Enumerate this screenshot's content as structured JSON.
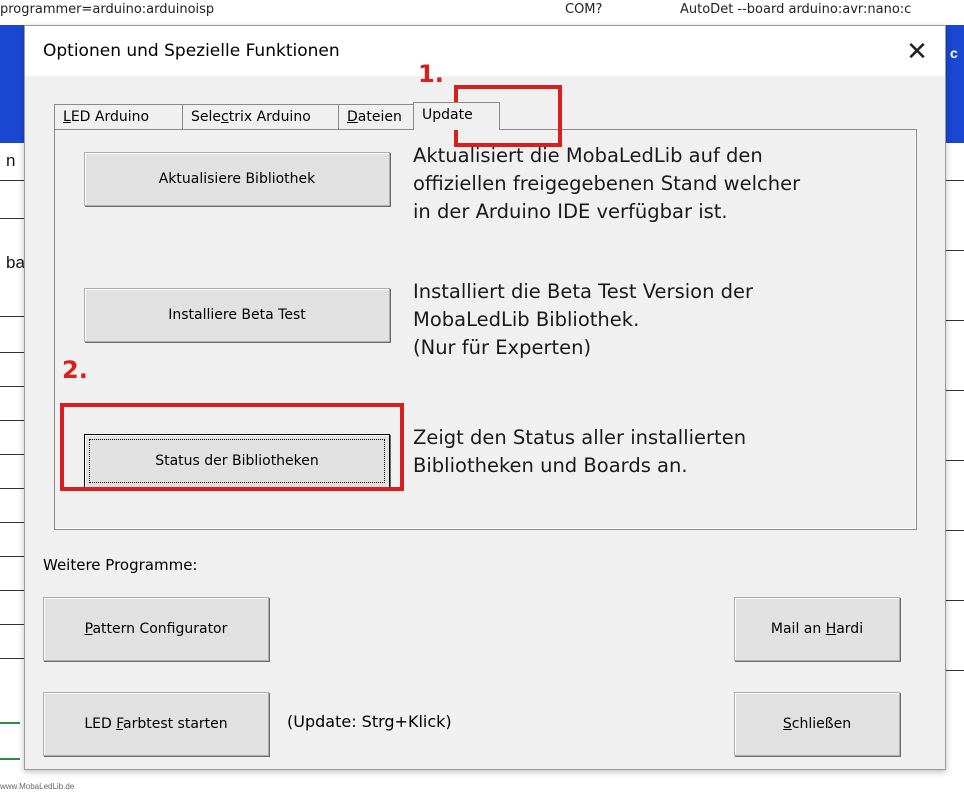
{
  "background": {
    "topbar": {
      "programmer": "programmer=arduino:arduinoisp",
      "port": "COM?",
      "autodet": "AutoDet --board arduino:avr:nano:c"
    },
    "right_strip_char": "c",
    "left_fragments": [
      "n",
      "ba"
    ],
    "footer": "www.MobaLedLib.de"
  },
  "dialog": {
    "title": "Optionen und Spezielle Funktionen",
    "close_symbol": "✕"
  },
  "tabs": [
    {
      "prefix": "",
      "accel": "L",
      "rest": "ED Arduino",
      "active": false
    },
    {
      "prefix": "Sele",
      "accel": "c",
      "rest": "trix Arduino",
      "active": false
    },
    {
      "prefix": "",
      "accel": "D",
      "rest": "ateien",
      "active": false
    },
    {
      "prefix": "Update",
      "accel": "",
      "rest": "",
      "active": true
    }
  ],
  "update_panel": {
    "update_library": {
      "button": "Aktualisiere Bibliothek",
      "description": [
        "Aktualisiert die MobaLedLib auf den",
        "offiziellen freigegebenen Stand welcher",
        "in der Arduino IDE verfügbar ist."
      ]
    },
    "install_beta": {
      "button": "Installiere Beta Test",
      "description": [
        "Installiert die Beta Test Version der",
        "MobaLedLib Bibliothek.",
        "(Nur für Experten)"
      ]
    },
    "library_status": {
      "button": "Status der Bibliotheken",
      "description": [
        "Zeigt den Status aller installierten",
        "Bibliotheken und Boards an."
      ]
    }
  },
  "further_programs_label": "Weitere Programme:",
  "buttons": {
    "pattern_configurator": {
      "accel": "P",
      "rest": "attern Configurator"
    },
    "mail_hardi": {
      "prefix": "Mail an ",
      "accel": "H",
      "rest": "ardi"
    },
    "led_color_test": {
      "prefix": "LED ",
      "accel": "F",
      "rest": "arbtest starten"
    },
    "close": {
      "accel": "S",
      "rest": "chließen"
    }
  },
  "hint_text": "(Update: Strg+Klick)",
  "annotations": {
    "step1": "1.",
    "step2": "2.",
    "highlight_color": "#d81f1f"
  }
}
